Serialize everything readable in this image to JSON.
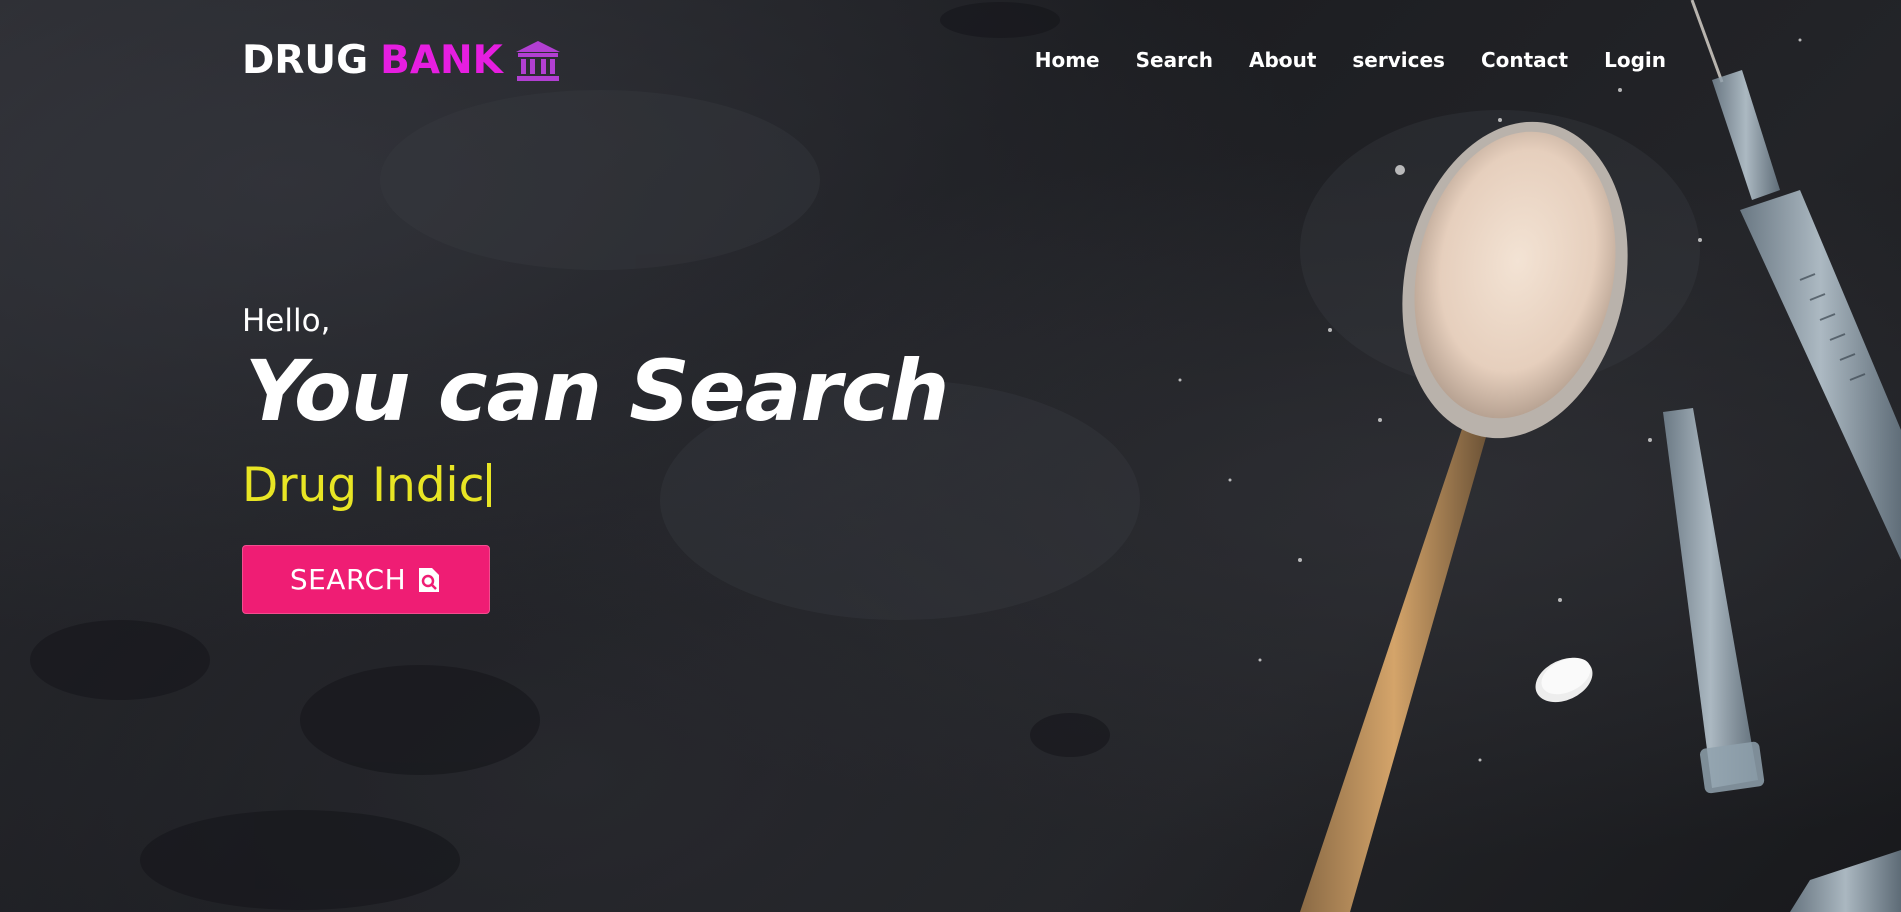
{
  "brand": {
    "word1": "DRUG",
    "word2": "BANK",
    "icon": "bank-building-icon",
    "colors": {
      "word1": "#ffffff",
      "word2": "#e61ee0",
      "icon": "#b23fd2"
    }
  },
  "nav": {
    "items": [
      {
        "label": "Home"
      },
      {
        "label": "Search"
      },
      {
        "label": "About"
      },
      {
        "label": "services"
      },
      {
        "label": "Contact"
      },
      {
        "label": "Login"
      }
    ]
  },
  "hero": {
    "greeting": "Hello,",
    "headline": "You can Search",
    "typed_text": "Drug Indic",
    "typed_color": "#e8e524",
    "button": {
      "label": "SEARCH",
      "icon": "search-document-icon",
      "color": "#ef1d74"
    }
  },
  "background": {
    "description_icon": "drug-spoon-syringe-photo"
  }
}
